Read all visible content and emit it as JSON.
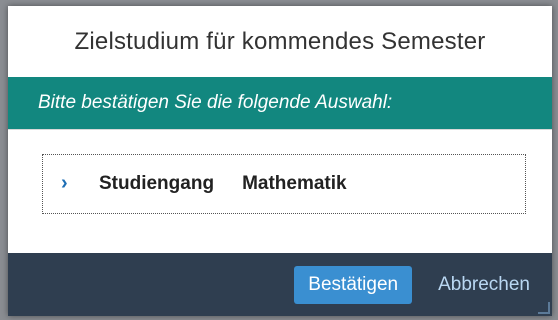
{
  "dialog": {
    "title": "Zielstudium für kommendes Semester",
    "info": "Bitte bestätigen Sie die folgende Auswahl:",
    "selection": {
      "label": "Studiengang",
      "value": "Mathematik",
      "expand_icon": "chevron-right-icon"
    },
    "buttons": {
      "confirm": "Bestätigen",
      "cancel": "Abbrechen"
    }
  },
  "colors": {
    "info_band": "#12877f",
    "footer": "#2f3e50",
    "primary_button": "#3a8fd1",
    "cancel_link": "#b9d7f2",
    "chevron": "#1f6fb5"
  }
}
